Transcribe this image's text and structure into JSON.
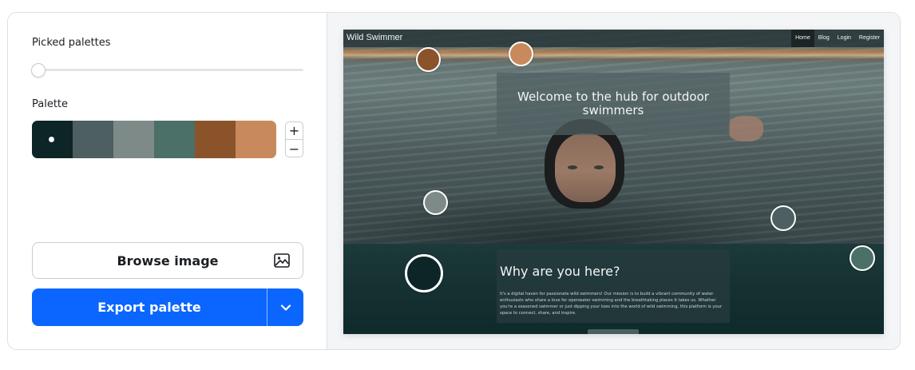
{
  "left_panel": {
    "picked_palettes_label": "Picked palettes",
    "slider_value": 0,
    "palette_label": "Palette",
    "palette": {
      "swatches": [
        "#0d2526",
        "#4d5f60",
        "#7d8a88",
        "#4a7067",
        "#8a532a",
        "#c88a5c"
      ],
      "selected_index": 0
    },
    "stepper": {
      "plus": "+",
      "minus": "−"
    },
    "browse_button": {
      "label": "Browse image",
      "icon": "image-icon"
    },
    "export_button": {
      "label": "Export palette",
      "dropdown_icon": "chevron-down-icon"
    }
  },
  "preview": {
    "site": {
      "title": "Wild Swimmer",
      "nav": [
        "Home",
        "Blog",
        "Login",
        "Register"
      ],
      "active_nav": "Home",
      "hero_text": "Welcome to the hub for outdoor swimmers",
      "section_title": "Why are you here?",
      "section_body": "It's a digital haven for passionate wild swimmers! Our mission is to build a vibrant community of water enthusiasts who share a love for openwater swimming and the breathtaking places it takes us. Whether you're a seasoned swimmer or just dipping your toes into the world of wild swimming, this platform is your space to connect, share, and inspire."
    },
    "color_pickers": [
      {
        "color": "#0d2526",
        "size": "large"
      },
      {
        "color": "#8a532a",
        "size": "normal"
      },
      {
        "color": "#c88a5c",
        "size": "normal"
      },
      {
        "color": "#7d8a88",
        "size": "normal"
      },
      {
        "color": "#4d5f60",
        "size": "normal"
      },
      {
        "color": "#4a7067",
        "size": "normal"
      }
    ]
  }
}
